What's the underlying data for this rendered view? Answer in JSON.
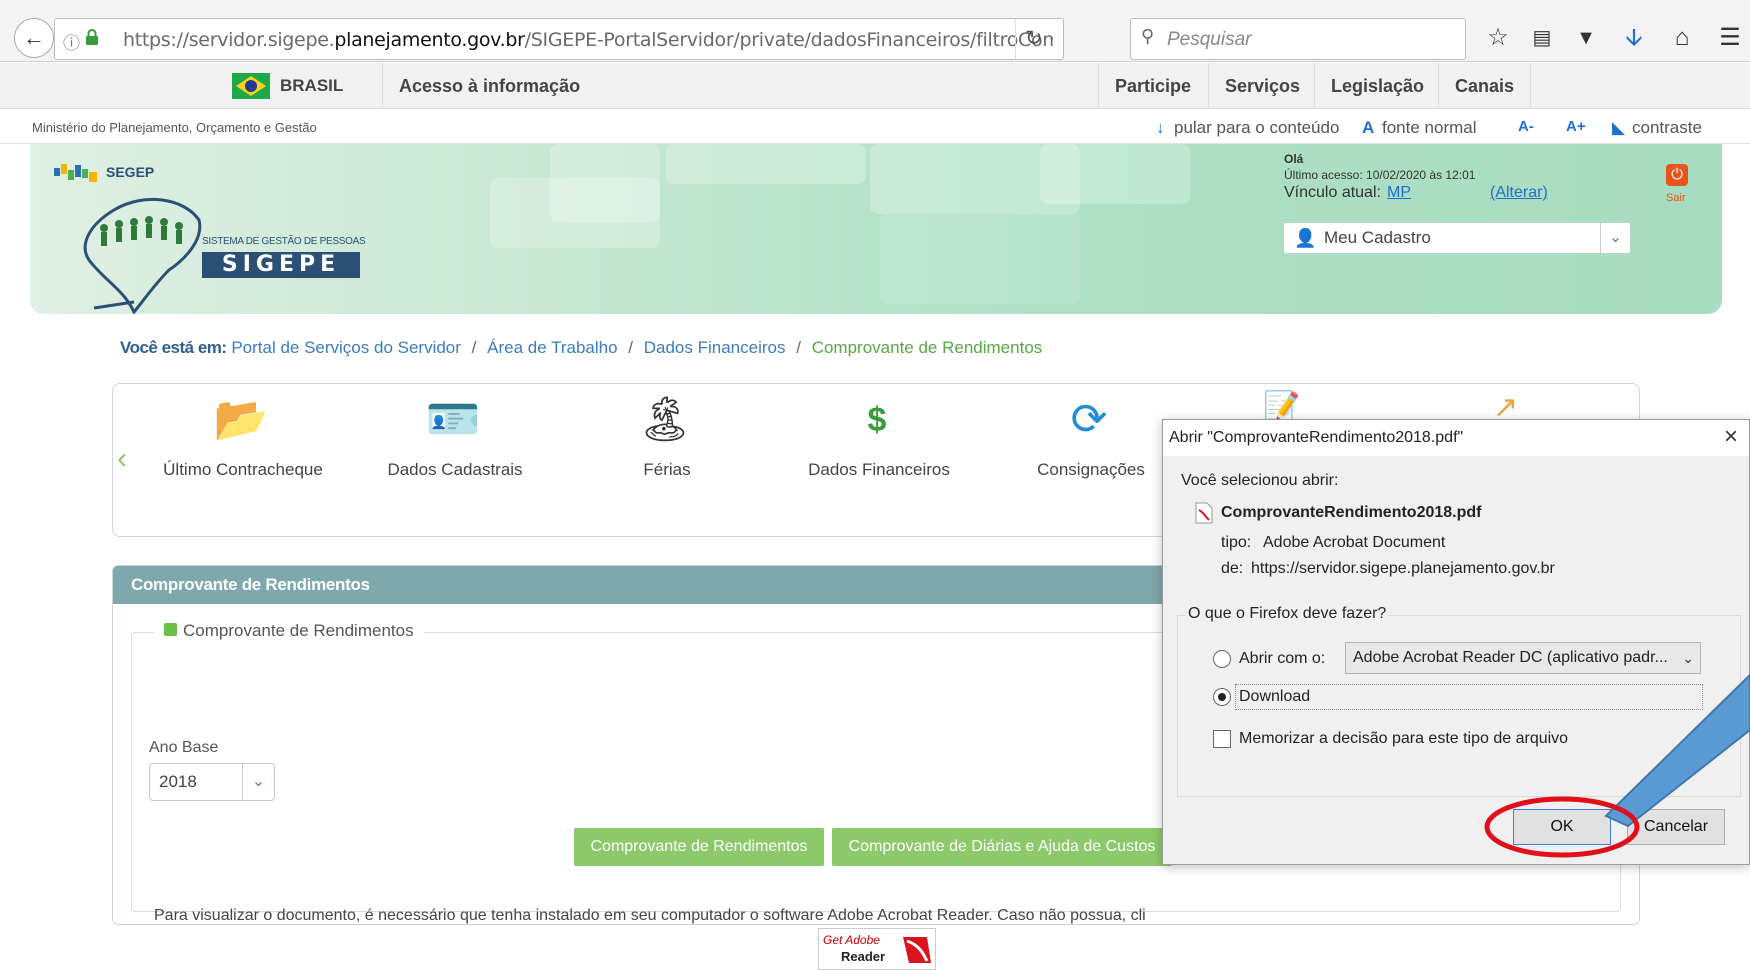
{
  "browser": {
    "url_prefix": "https://servidor.sigepe.",
    "url_domain": "planejamento.gov.br",
    "url_path": "/SIGEPE-PortalServidor/private/dadosFinanceiros/filtroComprovante",
    "search_placeholder": "Pesquisar"
  },
  "govbar": {
    "brasil": "BRASIL",
    "acesso": "Acesso à informação",
    "participe": "Participe",
    "servicos": "Serviços",
    "legislacao": "Legislação",
    "canais": "Canais"
  },
  "accbar": {
    "ministerio": "Ministério do Planejamento, Orçamento e Gestão",
    "pular": "pular para o conteúdo",
    "fonte": "fonte normal",
    "aminus": "A-",
    "aplus": "A+",
    "contraste": "contraste"
  },
  "header": {
    "segep": "SEGEP",
    "sistema": "SISTEMA DE GESTÃO DE PESSOAS",
    "sigepe": "SIGEPE",
    "ola": "Olá",
    "ultimo_acesso": "Último acesso: 10/02/2020 às 12:01",
    "vinculo_label": "Vínculo atual:",
    "vinculo_value": "MP",
    "alterar": "(Alterar)",
    "meu_cadastro": "Meu Cadastro",
    "sair": "Sair"
  },
  "breadcrumb": {
    "label": "Você está em:",
    "items": [
      "Portal de Serviços do Servidor",
      "Área de Trabalho",
      "Dados Financeiros",
      "Comprovante de Rendimentos"
    ]
  },
  "carousel": {
    "items": [
      "Último Contracheque",
      "Dados Cadastrais",
      "Férias",
      "Dados Financeiros",
      "Consignações"
    ]
  },
  "panel": {
    "title": "Comprovante de Rendimentos",
    "legend": "Comprovante de Rendimentos",
    "ano_label": "Ano Base",
    "ano_value": "2018",
    "btn_rendimentos": "Comprovante de Rendimentos",
    "btn_diarias": "Comprovante de Diárias e Ajuda de Custos",
    "info": "Para visualizar o documento, é necessário que tenha instalado em seu computador o software Adobe Acrobat Reader. Caso não possua, cli",
    "get_adobe_1": "Get Adobe",
    "get_adobe_2": "Reader"
  },
  "dialog": {
    "title": "Abrir \"ComprovanteRendimento2018.pdf\"",
    "voce": "Você selecionou abrir:",
    "filename": "ComprovanteRendimento2018.pdf",
    "tipo_label": "tipo:",
    "tipo_value": "Adobe Acrobat Document",
    "de_label": "de:",
    "de_value": "https://servidor.sigepe.planejamento.gov.br",
    "question": "O que o Firefox deve fazer?",
    "abrir_com": "Abrir com o:",
    "app": "Adobe Acrobat Reader DC  (aplicativo padr...",
    "download": "Download",
    "memorizar": "Memorizar a decisão para este tipo de arquivo",
    "ok": "OK",
    "cancelar": "Cancelar"
  },
  "colors": {
    "accent_green": "#8cc96a",
    "panel_header": "#7fa7ae",
    "annotation_red": "#e0101a",
    "callout_blue": "#5b9bd5"
  }
}
